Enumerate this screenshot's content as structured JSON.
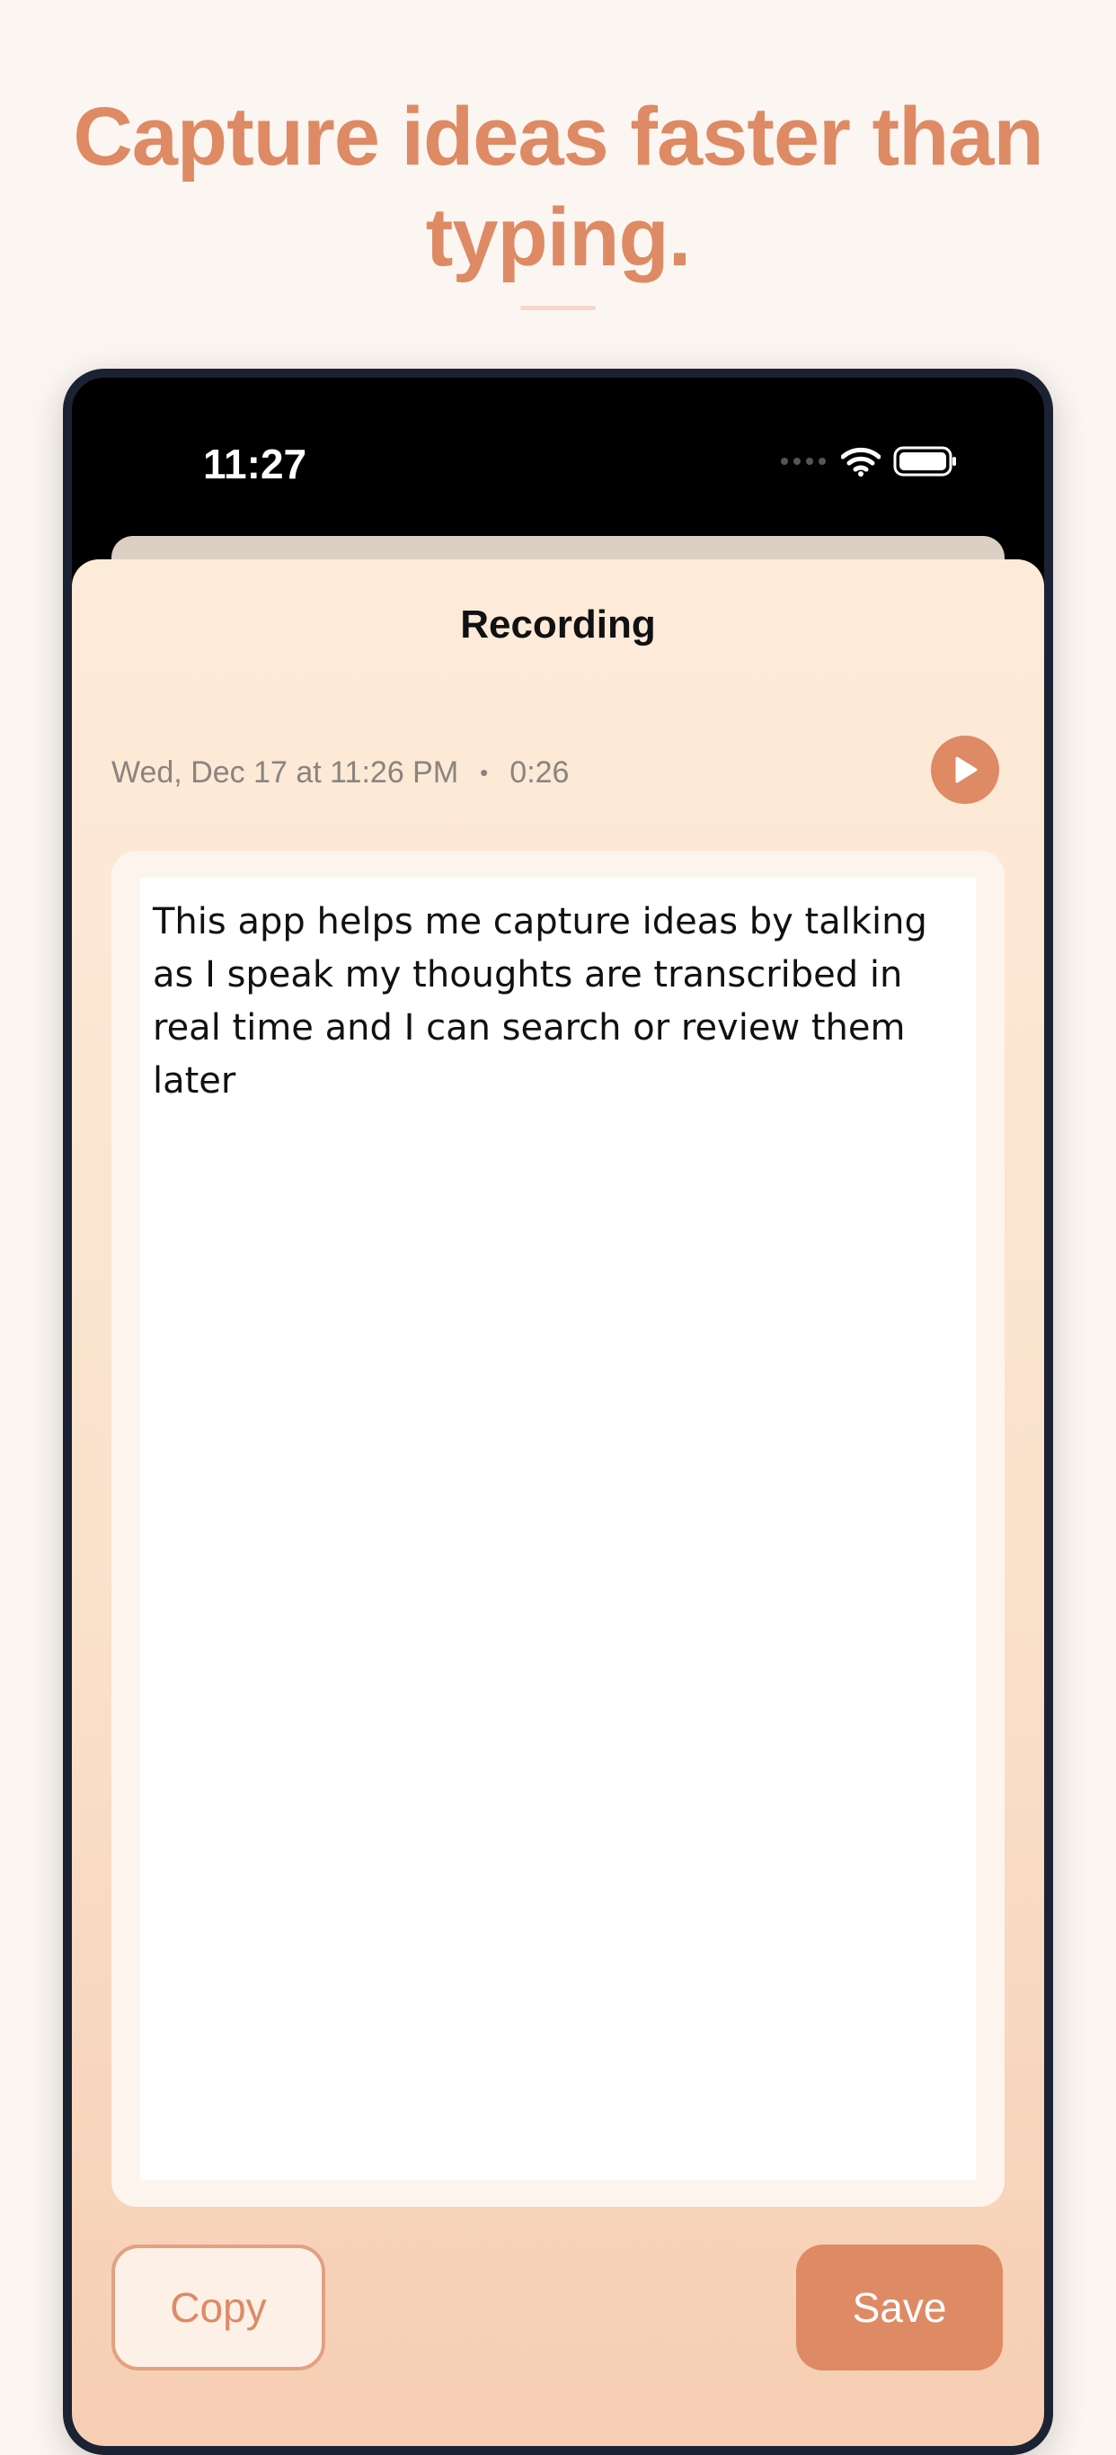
{
  "headline": {
    "line1": "Capture ideas faster than",
    "line2": "typing."
  },
  "status_bar": {
    "time": "11:27",
    "icons": [
      "cellular-signal-icon",
      "wifi-icon",
      "battery-icon"
    ]
  },
  "sheet": {
    "title": "Recording",
    "date": "Wed, Dec 17 at 11:26 PM",
    "separator": "•",
    "duration": "0:26",
    "transcript": "This app helps me capture ideas by talking as I speak my thoughts are transcribed in real time and I can search or review them later"
  },
  "actions": {
    "copy_label": "Copy",
    "save_label": "Save"
  },
  "colors": {
    "accent": "#de8a64",
    "page_background": "#fbf6f1",
    "frame": "#1b2233"
  }
}
